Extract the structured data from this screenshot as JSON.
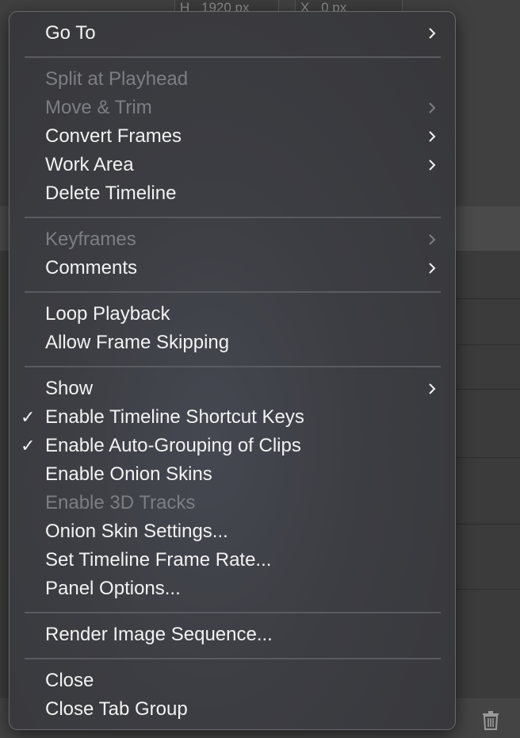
{
  "background": {
    "field_h_label": "H",
    "field_h_value": "1920 px",
    "field_x_label": "X",
    "field_x_value": "0 px"
  },
  "menu": {
    "items": [
      {
        "label": "Go To",
        "submenu": true,
        "enabled": true,
        "checked": false
      },
      {
        "label": "Split at Playhead",
        "submenu": false,
        "enabled": false,
        "checked": false
      },
      {
        "label": "Move & Trim",
        "submenu": true,
        "enabled": false,
        "checked": false
      },
      {
        "label": "Convert Frames",
        "submenu": true,
        "enabled": true,
        "checked": false
      },
      {
        "label": "Work Area",
        "submenu": true,
        "enabled": true,
        "checked": false
      },
      {
        "label": "Delete Timeline",
        "submenu": false,
        "enabled": true,
        "checked": false
      },
      {
        "label": "Keyframes",
        "submenu": true,
        "enabled": false,
        "checked": false
      },
      {
        "label": "Comments",
        "submenu": true,
        "enabled": true,
        "checked": false
      },
      {
        "label": "Loop Playback",
        "submenu": false,
        "enabled": true,
        "checked": false
      },
      {
        "label": "Allow Frame Skipping",
        "submenu": false,
        "enabled": true,
        "checked": false
      },
      {
        "label": "Show",
        "submenu": true,
        "enabled": true,
        "checked": false
      },
      {
        "label": "Enable Timeline Shortcut Keys",
        "submenu": false,
        "enabled": true,
        "checked": true
      },
      {
        "label": "Enable Auto-Grouping of Clips",
        "submenu": false,
        "enabled": true,
        "checked": true
      },
      {
        "label": "Enable Onion Skins",
        "submenu": false,
        "enabled": true,
        "checked": false
      },
      {
        "label": "Enable 3D Tracks",
        "submenu": false,
        "enabled": false,
        "checked": false
      },
      {
        "label": "Onion Skin Settings...",
        "submenu": false,
        "enabled": true,
        "checked": false
      },
      {
        "label": "Set Timeline Frame Rate...",
        "submenu": false,
        "enabled": true,
        "checked": false
      },
      {
        "label": "Panel Options...",
        "submenu": false,
        "enabled": true,
        "checked": false
      },
      {
        "label": "Render Image Sequence...",
        "submenu": false,
        "enabled": true,
        "checked": false
      },
      {
        "label": "Close",
        "submenu": false,
        "enabled": true,
        "checked": false
      },
      {
        "label": "Close Tab Group",
        "submenu": false,
        "enabled": true,
        "checked": false
      }
    ],
    "check_glyph": "✓"
  },
  "colors": {
    "enabled_text": "#f2f2f2",
    "disabled_text": "#7d7e83",
    "separator": "#5a5b60"
  }
}
